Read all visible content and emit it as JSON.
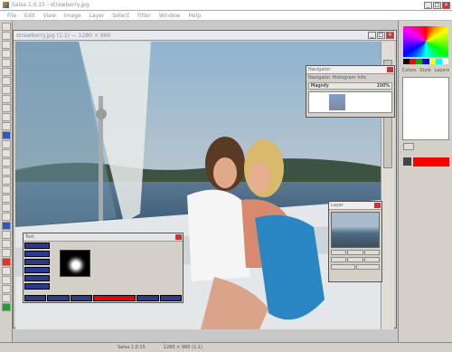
{
  "app": {
    "title": "Salsa 1.0.15 - strawberry.jpg"
  },
  "menubar": {
    "items": [
      "File",
      "Edit",
      "View",
      "Image",
      "Layer",
      "Select",
      "Filter",
      "Window",
      "Help"
    ]
  },
  "document": {
    "title": "strawberry.jpg (1:1) — 1280 × 960"
  },
  "navigator": {
    "title": "Navigator",
    "tabs": [
      "Navigator",
      "Histogram",
      "Info"
    ],
    "zoom_label": "Magnify",
    "zoom_value": "100%"
  },
  "selection_panel": {
    "title": "Layer"
  },
  "text_panel": {
    "title": "Text",
    "tabs": [
      "Tool",
      "Lasso",
      "Pen"
    ],
    "buttons": [
      "Text",
      "Vector",
      "Gradient"
    ],
    "fields": {
      "f1": "0%",
      "f2": "0%"
    },
    "bottom": [
      "Color",
      "Blend",
      "Fill",
      "Style",
      "Apply",
      "Layers"
    ]
  },
  "right_panel": {
    "tabs": [
      "Colors",
      "Style",
      "Layers"
    ],
    "foreground_color": "#ff0000"
  },
  "statusbar": {
    "left": "Salsa 1.0.15",
    "mid": "1280 × 960 (1:1)"
  },
  "colors": {
    "toolbar_blue": "#3656b8",
    "accent_red": "#ff0000"
  }
}
